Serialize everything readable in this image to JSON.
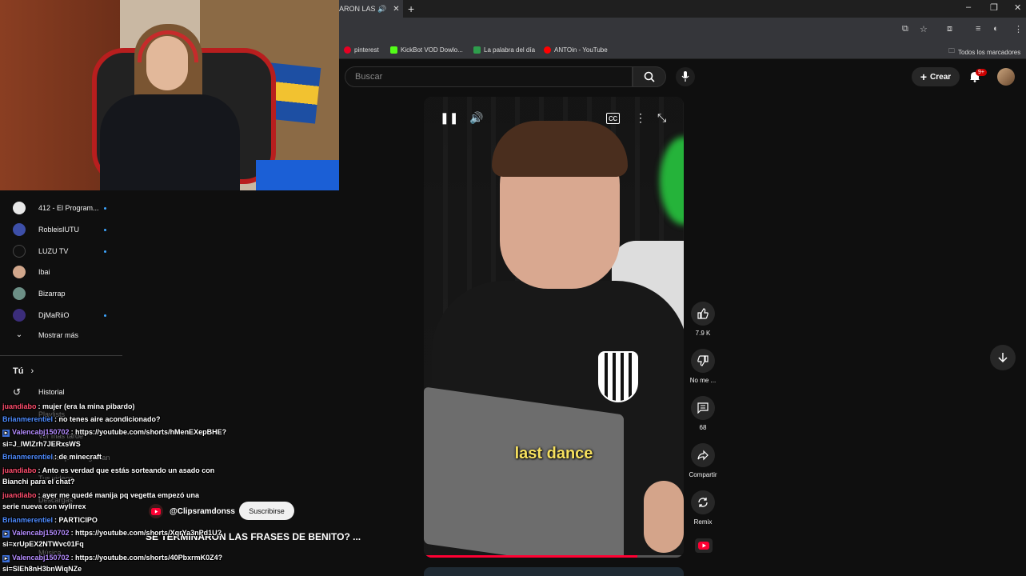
{
  "browser": {
    "tab_title": "ARON LAS F",
    "window_controls": [
      "–",
      "❐",
      "✕"
    ],
    "bookmarks": [
      {
        "label": "pinterest",
        "color": "#e60023"
      },
      {
        "label": "KickBot VOD Dowlo...",
        "color": "#53fc18"
      },
      {
        "label": "La palabra del día",
        "color": "#2e9d4c"
      },
      {
        "label": "ANTOin - YouTube",
        "color": "#ff0000"
      }
    ],
    "all_bookmarks": "Todos los marcadores"
  },
  "header": {
    "search_placeholder": "Buscar",
    "create_label": "Crear",
    "notif_badge": "9+"
  },
  "sidebar": {
    "subscriptions": [
      {
        "name": "412 - El Program...",
        "color": "#e8e8e8"
      },
      {
        "name": "RobleisIUTU",
        "color": "#3d4fa8"
      },
      {
        "name": "LUZU TV",
        "color": "#111111"
      },
      {
        "name": "Ibai",
        "color": "#d1a78c"
      },
      {
        "name": "Bizarrap",
        "color": "#6c8f86"
      },
      {
        "name": "DjMaRiiO",
        "color": "#3b2d7a"
      }
    ],
    "show_more": "Mostrar más",
    "you_section": "Tú",
    "history": "Historial",
    "faded_items": [
      "Playlists",
      "Ver más tarde",
      "Videos que me gustan",
      "Tus videos",
      "Descargas",
      "Música"
    ]
  },
  "chat": [
    {
      "user": "juandiabo",
      "color": "#ff4d6d",
      "text": ": mujer (era la mina pibardo)",
      "badge": false
    },
    {
      "user": "Brianmerentiel",
      "color": "#4f8cff",
      "text": ": no tenes aire acondicionado?",
      "badge": false
    },
    {
      "user": "Valencabj150702",
      "color": "#b58cff",
      "text": ": https://youtube.com/shorts/hMenEXepBHE?",
      "badge": true
    },
    {
      "user": "",
      "color": "#ffffff",
      "text": "si=J_lWIZrh7JERxsWS",
      "badge": false
    },
    {
      "user": "Brianmerentiel",
      "color": "#4f8cff",
      "text": ": de minecraft",
      "badge": false
    },
    {
      "user": "juandiabo",
      "color": "#ff4d6d",
      "text": ": Anto es verdad que estás sorteando un asado con",
      "badge": false
    },
    {
      "user": "",
      "color": "#ffffff",
      "text": "Bianchi para el chat?",
      "badge": false
    },
    {
      "user": "juandiabo",
      "color": "#ff4d6d",
      "text": ": ayer me quedé manija pq vegetta empezó una",
      "badge": false
    },
    {
      "user": "",
      "color": "#ffffff",
      "text": "serie nueva con wylirrex",
      "badge": false
    },
    {
      "user": "Brianmerentiel",
      "color": "#4f8cff",
      "text": ": PARTICIPO",
      "badge": false
    },
    {
      "user": "Valencabj150702",
      "color": "#b58cff",
      "text": ": https://youtube.com/shorts/XqrYa3nPd1U?",
      "badge": true
    },
    {
      "user": "",
      "color": "#ffffff",
      "text": "si=xrUpEX2NTWvc01Fq",
      "badge": false
    },
    {
      "user": "Valencabj150702",
      "color": "#b58cff",
      "text": ": https://youtube.com/shorts/40PbxrmK0Z4?",
      "badge": true
    },
    {
      "user": "",
      "color": "#ffffff",
      "text": "si=SIEh8nH3bnWiqNZe",
      "badge": false
    }
  ],
  "short": {
    "caption": "last dance",
    "channel": "@Clipsramdonss",
    "subscribe": "Suscribirse",
    "title": "SE TERMINARON LAS FRASES DE BENITO? ...",
    "progress": 0.82,
    "likes": "7.9 K",
    "dislike_label": "No me ...",
    "comments": "68",
    "share": "Compartir",
    "remix": "Remix"
  }
}
